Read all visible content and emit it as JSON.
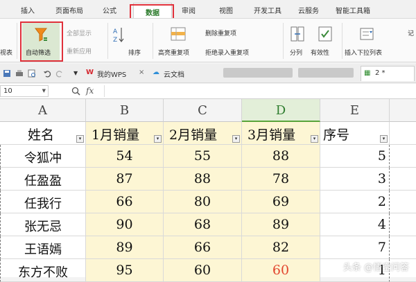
{
  "ribbon_tabs": [
    "插入",
    "页面布局",
    "公式",
    "数据",
    "审阅",
    "视图",
    "开发工具",
    "云服务",
    "智能工具箱"
  ],
  "active_tab": "数据",
  "ribbon": {
    "left_cut": "视表",
    "auto_filter": "自动筛选",
    "show_all": "全部显示",
    "reapply": "重新应用",
    "sort": "排序",
    "highlight_dup": "高亮重复项",
    "delete_dup": "删除重复项",
    "reject_dup": "拒绝录入重复项",
    "split": "分列",
    "validity": "有效性",
    "dropdown": "插入下拉列表",
    "record": "记"
  },
  "doc_tabs": {
    "my_wps": "我的WPS",
    "cloud": "云文档",
    "current": "2 *"
  },
  "formula_bar": {
    "name_box": "10",
    "fx": "fx"
  },
  "columns": [
    "A",
    "B",
    "C",
    "D",
    "E"
  ],
  "header": [
    "姓名",
    "1月销量",
    "2月销量",
    "3月销量",
    "序号"
  ],
  "rows": [
    {
      "name": "令狐冲",
      "m1": "54",
      "m2": "55",
      "m3": "88",
      "no": "5"
    },
    {
      "name": "任盈盈",
      "m1": "87",
      "m2": "88",
      "m3": "78",
      "no": "3"
    },
    {
      "name": "任我行",
      "m1": "66",
      "m2": "80",
      "m3": "69",
      "no": "2"
    },
    {
      "name": "张无忌",
      "m1": "90",
      "m2": "68",
      "m3": "89",
      "no": "4"
    },
    {
      "name": "王语嫣",
      "m1": "89",
      "m2": "66",
      "m3": "82",
      "no": "7"
    },
    {
      "name": "东方不败",
      "m1": "95",
      "m2": "60",
      "m3": "60",
      "no": "1"
    }
  ],
  "watermark": "头条 @悟空问答",
  "colors": {
    "highlight_fill": "#fdf6d4",
    "selected_column": "#e3efd9",
    "red_value": "#e2462e",
    "annotation_box": "#e0303a"
  }
}
